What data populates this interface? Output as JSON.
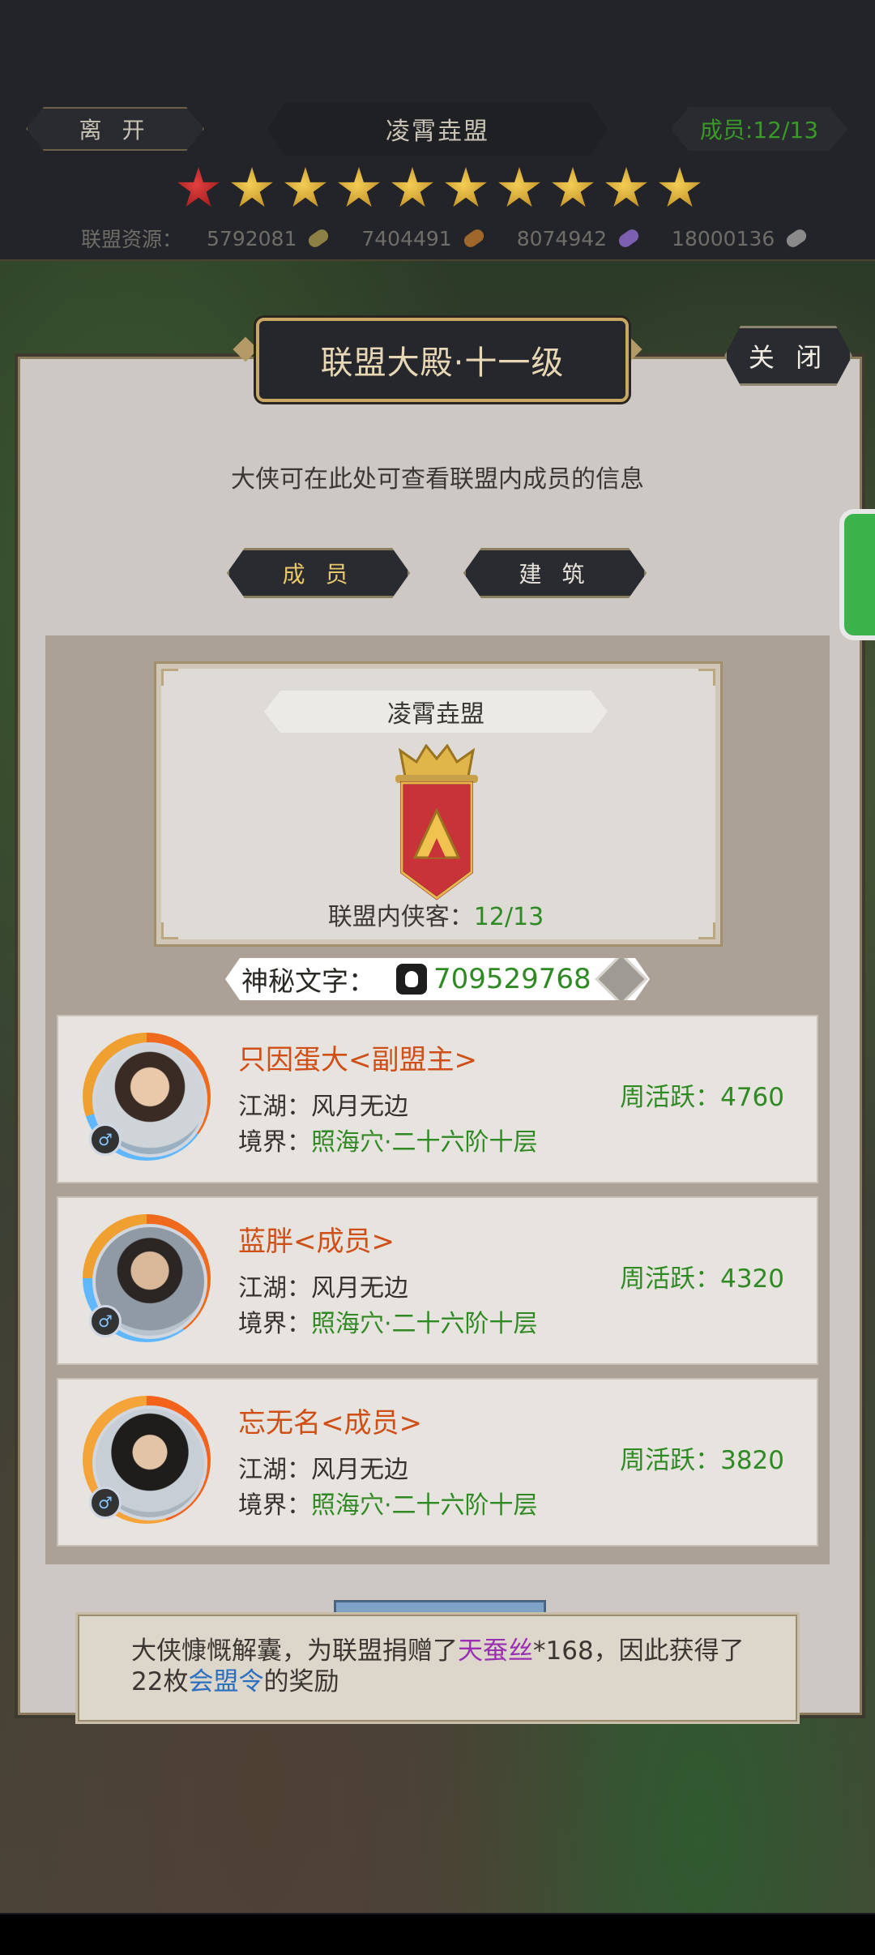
{
  "top": {
    "leave_label": "离 开",
    "guild_title": "凌霄垚盟",
    "members_badge": "成员:12/13",
    "stars": {
      "red": 1,
      "gold": 9
    },
    "resources_label": "联盟资源：",
    "resources": [
      {
        "value": "5792081",
        "color": "#8c8045"
      },
      {
        "value": "7404491",
        "color": "#a0672a"
      },
      {
        "value": "8074942",
        "color": "#7c5fb0"
      },
      {
        "value": "18000136",
        "color": "#8a8a8a"
      }
    ]
  },
  "panel": {
    "title": "联盟大殿·十一级",
    "close_label": "关 闭",
    "description": "大侠可在此处可查看联盟内成员的信息",
    "tabs": [
      {
        "label": "成 员",
        "active": true
      },
      {
        "label": "建 筑",
        "active": false
      }
    ]
  },
  "guild": {
    "name": "凌霄垚盟",
    "count_label": "联盟内侠客：",
    "count_value": "12/13"
  },
  "secret": {
    "label": "神秘文字：",
    "value": "709529768"
  },
  "members": [
    {
      "name": "只因蛋大<副盟主>",
      "jianghu_label": "江湖：",
      "jianghu": "风月无边",
      "realm_label": "境界：",
      "realm": "照海穴·二十六阶十层",
      "activity": "周活跃：4760",
      "gender": "♂"
    },
    {
      "name": "蓝胖<成员>",
      "jianghu_label": "江湖：",
      "jianghu": "风月无边",
      "realm_label": "境界：",
      "realm": "照海穴·二十六阶十层",
      "activity": "周活跃：4320",
      "gender": "♂"
    },
    {
      "name": "忘无名<成员>",
      "jianghu_label": "江湖：",
      "jianghu": "风月无边",
      "realm_label": "境界：",
      "realm": "照海穴·二十六阶十层",
      "activity": "周活跃：3820",
      "gender": "♂"
    }
  ],
  "toast": {
    "part1": "大侠慷慨解囊，为联盟捐赠了",
    "item": "天蚕丝",
    "part2": "*168，因此获得了22枚",
    "reward": "会盟令",
    "part3": "的奖励"
  },
  "colors": {
    "accent_green": "#2f8a24",
    "name_orange": "#cf4f16",
    "gold_border": "#c9a863"
  }
}
